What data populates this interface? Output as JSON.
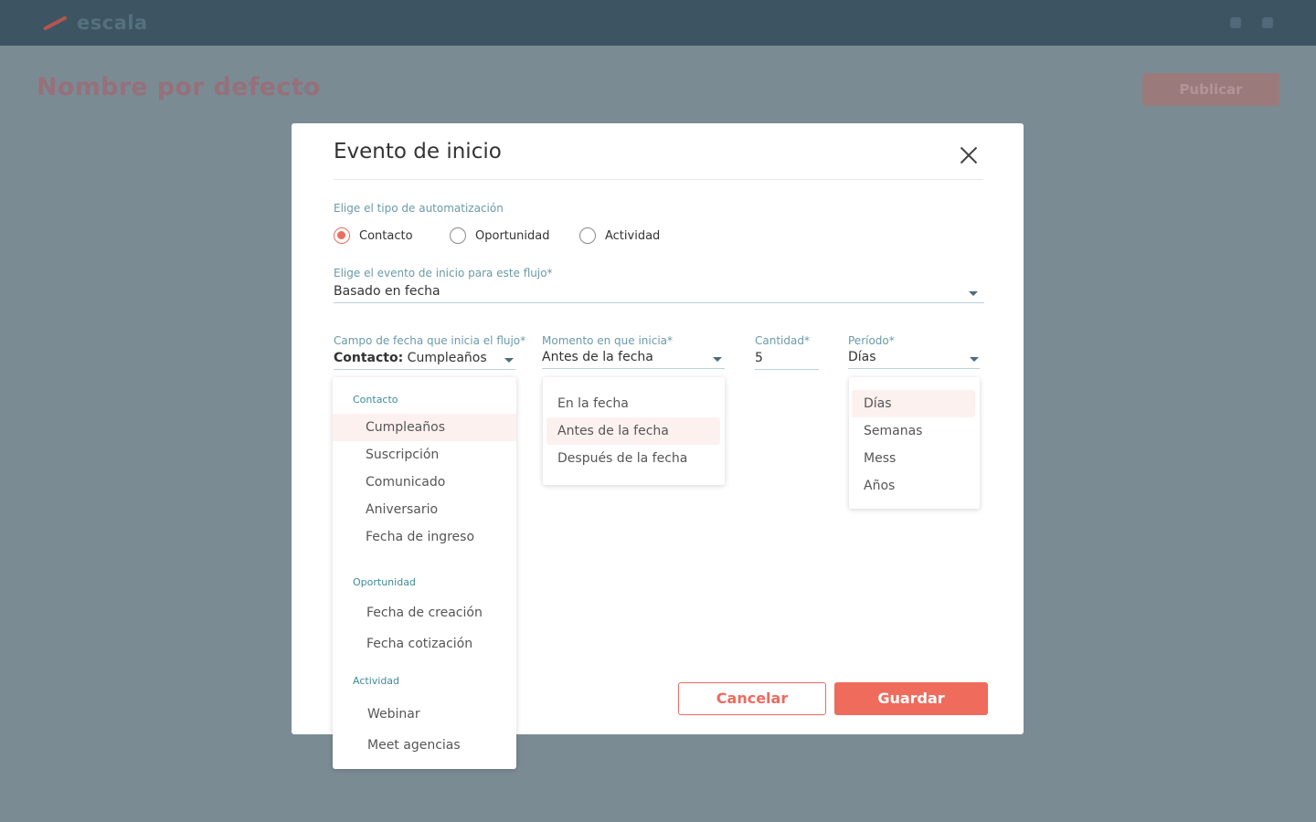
{
  "app": {
    "logo_text": "escala"
  },
  "background": {
    "page_title": "Nombre por defecto",
    "action_label": "Publicar"
  },
  "modal": {
    "title": "Evento de inicio",
    "automation_type": {
      "label": "Elige el tipo de automatización",
      "options": [
        "Contacto",
        "Oportunidad",
        "Actividad"
      ],
      "selected": "Contacto"
    },
    "start_event": {
      "label": "Elige el evento de inicio para este flujo*",
      "value": "Basado en fecha"
    },
    "date_field": {
      "label": "Campo de fecha que inicia el flujo*",
      "value_prefix": "Contacto:",
      "value": "Cumpleaños",
      "dropdown": {
        "groups": [
          {
            "name": "Contacto",
            "items": [
              "Cumpleaños",
              "Suscripción",
              "Comunicado",
              "Aniversario",
              "Fecha de ingreso"
            ]
          },
          {
            "name": "Oportunidad",
            "items": [
              "Fecha de creación",
              "Fecha cotización"
            ]
          },
          {
            "name": "Actividad",
            "items": [
              "Webinar",
              "Meet agencias"
            ]
          }
        ],
        "selected": "Cumpleaños"
      }
    },
    "moment": {
      "label": "Momento en que inicia*",
      "value": "Antes de la fecha",
      "options": [
        "En la fecha",
        "Antes de la fecha",
        "Después de la fecha"
      ],
      "selected": "Antes de la fecha"
    },
    "quantity": {
      "label": "Cantidad*",
      "value": "5"
    },
    "period": {
      "label": "Período*",
      "value": "Días",
      "options": [
        "Días",
        "Semanas",
        "Mess",
        "Años"
      ],
      "selected": "Días"
    },
    "buttons": {
      "cancel": "Cancelar",
      "save": "Guardar"
    }
  },
  "colors": {
    "accent": "#ef6b5c",
    "label": "#6a9aa8",
    "overlay": "#7b8b94",
    "topbar": "#3d5463"
  }
}
